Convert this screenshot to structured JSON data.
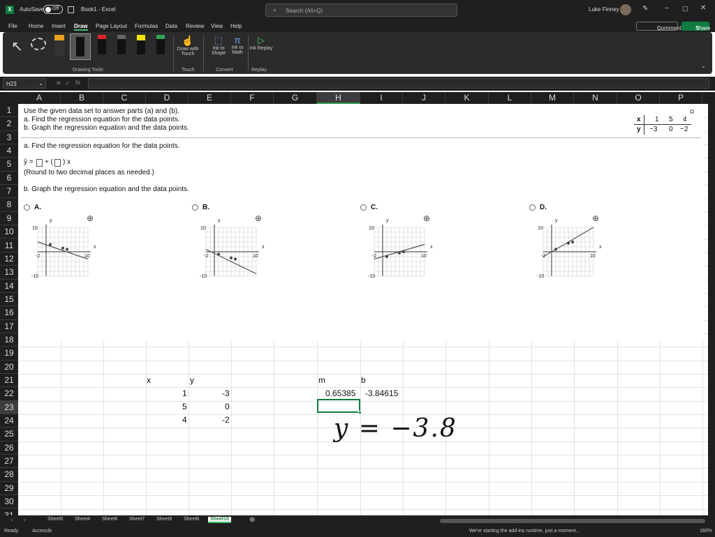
{
  "titlebar": {
    "autosave": "AutoSave",
    "toggle": "Off",
    "title": "Book1 - Excel",
    "search": "Search (Alt+Q)",
    "user": "Luke Finney"
  },
  "tabs": [
    "File",
    "Home",
    "Insert",
    "Draw",
    "Page Layout",
    "Formulas",
    "Data",
    "Review",
    "View",
    "Help"
  ],
  "buttons": {
    "comments": "Comments",
    "share": "Share"
  },
  "ribbon": {
    "drawing_tools": "Drawing Tools",
    "draw_with_touch": "Draw with Touch",
    "touch": "Touch",
    "ink_to_shape": "Ink to Shape",
    "ink_to_math": "Ink to Math",
    "convert": "Convert",
    "ink_replay": "Ink Replay",
    "replay": "Replay"
  },
  "namebox": "H23",
  "columns": [
    "A",
    "B",
    "C",
    "D",
    "E",
    "F",
    "G",
    "H",
    "I",
    "J",
    "K",
    "L",
    "M",
    "N",
    "O",
    "P"
  ],
  "rows": [
    "1",
    "2",
    "3",
    "4",
    "5",
    "6",
    "7",
    "8",
    "9",
    "10",
    "11",
    "12",
    "13",
    "14",
    "15",
    "16",
    "17",
    "18",
    "19",
    "20",
    "21",
    "22",
    "23",
    "24",
    "25",
    "26",
    "27",
    "28",
    "29",
    "30",
    "31"
  ],
  "problem": {
    "line1": "Use the given data set to answer parts (a) and (b).",
    "line2": "a. Find the regression equation for the data points.",
    "line3": "b. Graph the regression equation and the data points.",
    "table": {
      "x_label": "x",
      "y_label": "y",
      "x": [
        "1",
        "5",
        "4"
      ],
      "y": [
        "−3",
        "0",
        "−2"
      ]
    },
    "part_a": "a. Find the regression equation for the data points.",
    "round": "(Round to two decimal places as needed.)",
    "part_b": "b. Graph the regression equation and the data points.",
    "options": [
      "A.",
      "B.",
      "C.",
      "D."
    ],
    "axis": {
      "ymax": "10",
      "ymin": "-10",
      "xmin": "-2",
      "xmax": "10",
      "xlab": "x",
      "ylab": "y"
    }
  },
  "cells": {
    "x_head": "x",
    "y_head": "y",
    "m_head": "m",
    "b_head": "b",
    "x_vals": [
      "1",
      "5",
      "4"
    ],
    "y_vals": [
      "-3",
      "0",
      "-2"
    ],
    "m_val": "0.65385",
    "b_val": "-3.84615"
  },
  "handwriting": "y = −3.8",
  "sheets": [
    "Sheet5",
    "Sheet4",
    "Sheet6",
    "Sheet7",
    "Sheet9",
    "Sheet8",
    "Sheet10"
  ],
  "status": {
    "ready": "Ready",
    "accessibility": "Accessib",
    "addins": "We're starting the add-ins runtime, just a moment...",
    "zoom": "160%"
  },
  "colors": {
    "excel_green": "#107c41",
    "accent": "#2e9a4d"
  }
}
